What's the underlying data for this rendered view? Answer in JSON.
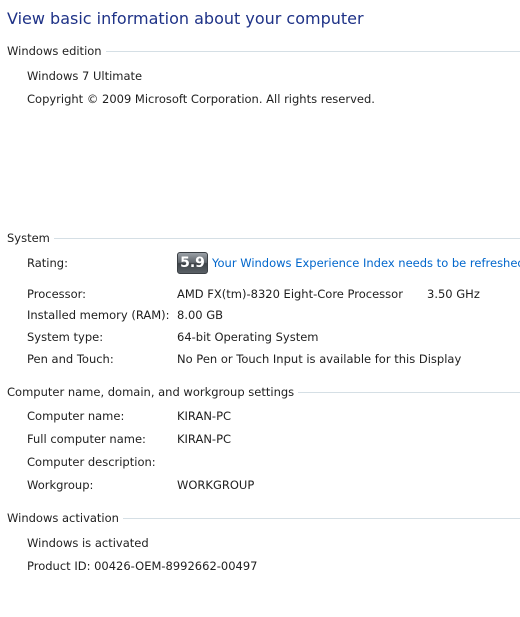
{
  "page": {
    "title": "View basic information about your computer"
  },
  "edition": {
    "header": "Windows edition",
    "name": "Windows 7 Ultimate",
    "copyright": "Copyright © 2009 Microsoft Corporation.  All rights reserved."
  },
  "system": {
    "header": "System",
    "rating": {
      "label": "Rating:",
      "score": "5.9",
      "link": "Your Windows Experience Index needs to be refreshed"
    },
    "processor": {
      "label": "Processor:",
      "value": "AMD FX(tm)-8320 Eight-Core Processor",
      "speed": "3.50 GHz"
    },
    "memory": {
      "label": "Installed memory (RAM):",
      "value": "8.00 GB"
    },
    "type": {
      "label": "System type:",
      "value": "64-bit Operating System"
    },
    "pen": {
      "label": "Pen and Touch:",
      "value": "No Pen or Touch Input is available for this Display"
    }
  },
  "network": {
    "header": "Computer name, domain, and workgroup settings",
    "computer_name": {
      "label": "Computer name:",
      "value": "KIRAN-PC"
    },
    "full_name": {
      "label": "Full computer name:",
      "value": "KIRAN-PC"
    },
    "description": {
      "label": "Computer description:",
      "value": ""
    },
    "workgroup": {
      "label": "Workgroup:",
      "value": "WORKGROUP"
    }
  },
  "activation": {
    "header": "Windows activation",
    "status": "Windows is activated",
    "product_id": "Product ID:  00426-OEM-8992662-00497"
  }
}
